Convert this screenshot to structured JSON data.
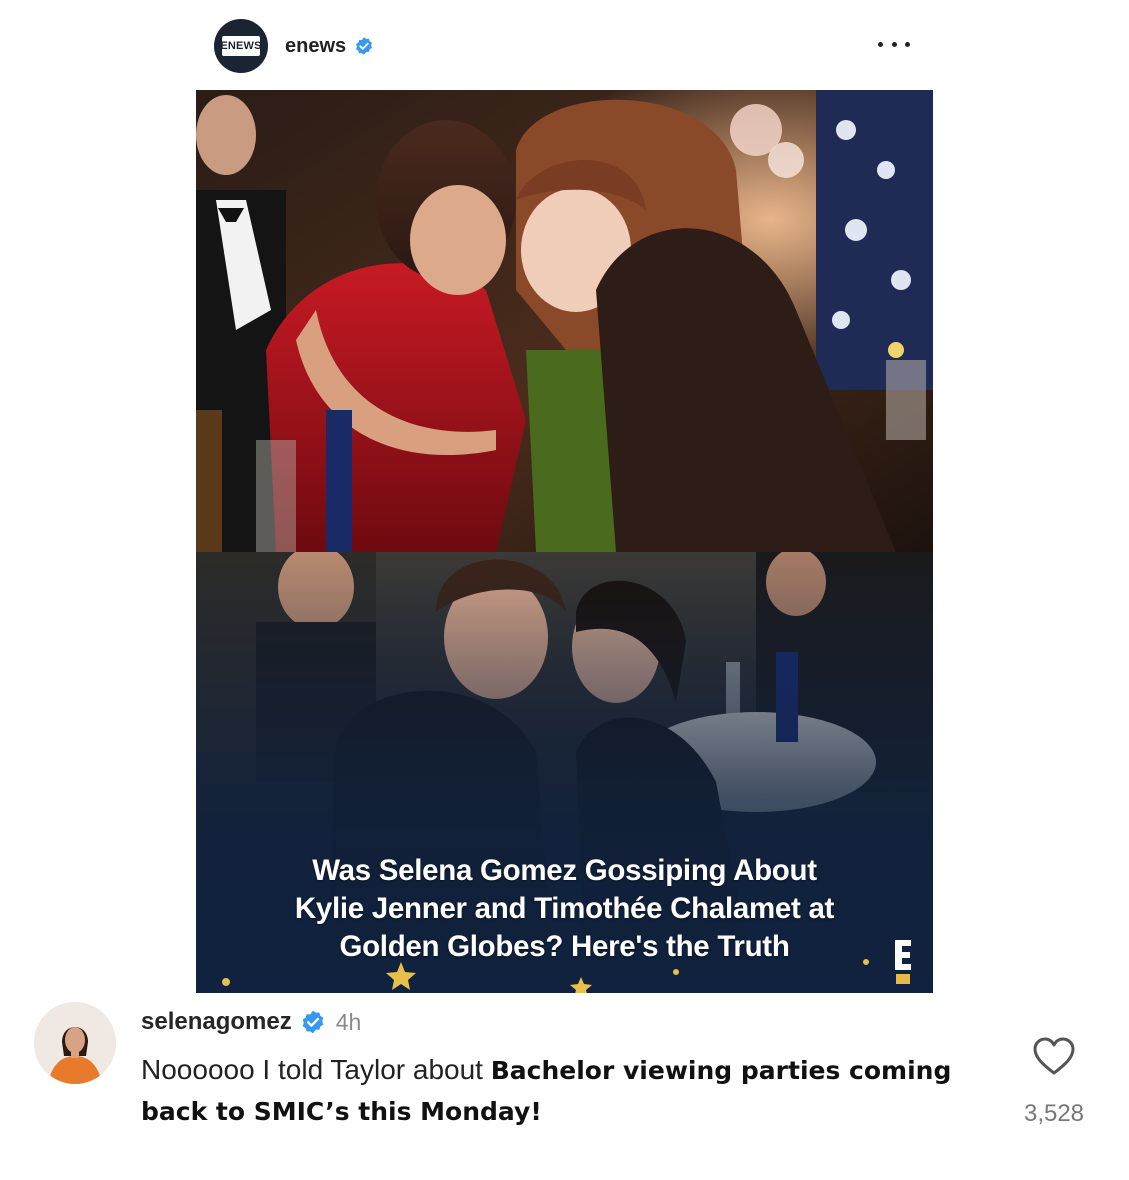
{
  "post": {
    "account": {
      "avatar_logo_text": "ENEWS",
      "username": "enews",
      "verified": true
    },
    "more_icon": "more-horizontal-icon",
    "image": {
      "headline_lines": [
        "Was Selena Gomez Gossiping About",
        "Kylie Jenner and Timothée Chalamet at",
        "Golden Globes? Here's the Truth"
      ],
      "logo_text": "E"
    }
  },
  "comment": {
    "username": "selenagomez",
    "verified": true,
    "time": "4h",
    "text_regular": "Noooooo I told Taylor about ",
    "text_bold": "Bachelor viewing parties coming back to SMIC’s this Monday!",
    "like_icon": "heart-outline-icon",
    "like_count": "3,528"
  },
  "colors": {
    "verified_blue": "#3897f0",
    "enews_navy": "#1b2433",
    "headline_overlay": "#10223f",
    "dress_red": "#a3121a"
  }
}
